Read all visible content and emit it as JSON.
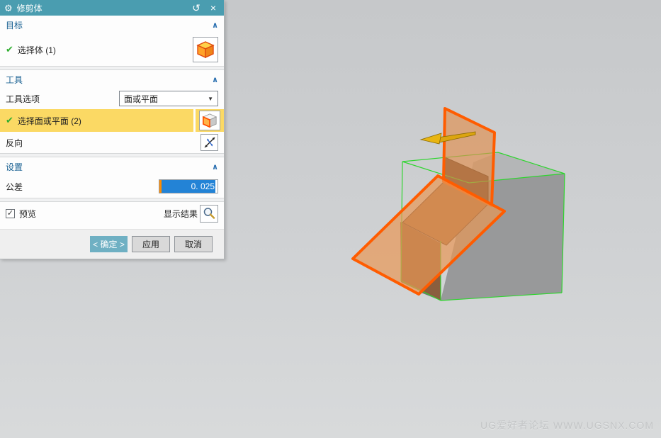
{
  "dialog": {
    "title": "修剪体",
    "titlebar": {
      "reset_glyph": "↺",
      "close_glyph": "×",
      "gear_glyph": "⚙"
    },
    "target": {
      "header": "目标",
      "select_body_label": "选择体 (1)"
    },
    "tool": {
      "header": "工具",
      "tool_option_label": "工具选项",
      "tool_option_value": "面或平面",
      "select_face_label": "选择面或平面 (2)",
      "reverse_label": "反向"
    },
    "settings": {
      "header": "设置",
      "tolerance_label": "公差",
      "tolerance_value": "0. 025"
    },
    "preview": {
      "checkbox_label": "预览",
      "checkbox_checked": "✓",
      "show_result_label": "显示结果"
    },
    "buttons": {
      "ok": "< 确定 >",
      "apply": "应用",
      "cancel": "取消"
    },
    "glyphs": {
      "chevron_up": "∧",
      "check": "✔",
      "dropdown_arrow": "▼"
    }
  },
  "viewport": {
    "watermark": "UG爱好者论坛 WWW.UGSNX.COM"
  },
  "colors": {
    "titlebar_teal": "#4a9db0",
    "highlight_yellow": "#fbd964",
    "selection_blue": "#2383d6",
    "plane_orange_border": "#ff5c00",
    "plane_orange_fill": "rgba(232,151,86,0.70)",
    "wireframe_green": "#2ed52e",
    "arrow_gold": "#e0a90f",
    "ok_button_teal": "#6fb0c3"
  }
}
